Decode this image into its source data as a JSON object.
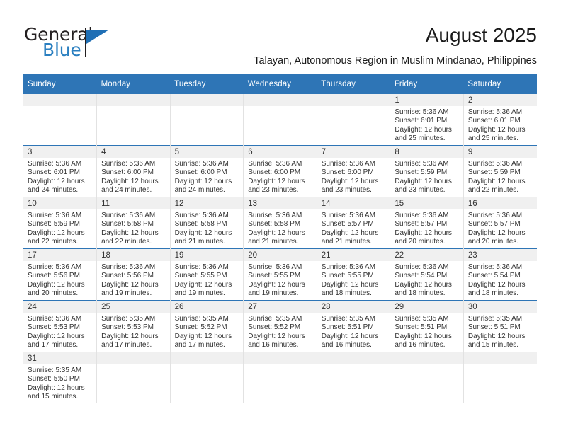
{
  "brand": {
    "name_part1": "General",
    "name_part2": "Blue",
    "accent_color": "#2e75b6",
    "logo_icon": "triangle-flag-icon"
  },
  "header": {
    "title": "August 2025",
    "subtitle": "Talayan, Autonomous Region in Muslim Mindanao, Philippines"
  },
  "calendar": {
    "weekday_headers": [
      "Sunday",
      "Monday",
      "Tuesday",
      "Wednesday",
      "Thursday",
      "Friday",
      "Saturday"
    ],
    "weeks": [
      [
        {
          "day": "",
          "sunrise": "",
          "sunset": "",
          "daylight_line1": "",
          "daylight_line2": ""
        },
        {
          "day": "",
          "sunrise": "",
          "sunset": "",
          "daylight_line1": "",
          "daylight_line2": ""
        },
        {
          "day": "",
          "sunrise": "",
          "sunset": "",
          "daylight_line1": "",
          "daylight_line2": ""
        },
        {
          "day": "",
          "sunrise": "",
          "sunset": "",
          "daylight_line1": "",
          "daylight_line2": ""
        },
        {
          "day": "",
          "sunrise": "",
          "sunset": "",
          "daylight_line1": "",
          "daylight_line2": ""
        },
        {
          "day": "1",
          "sunrise": "Sunrise: 5:36 AM",
          "sunset": "Sunset: 6:01 PM",
          "daylight_line1": "Daylight: 12 hours",
          "daylight_line2": "and 25 minutes."
        },
        {
          "day": "2",
          "sunrise": "Sunrise: 5:36 AM",
          "sunset": "Sunset: 6:01 PM",
          "daylight_line1": "Daylight: 12 hours",
          "daylight_line2": "and 25 minutes."
        }
      ],
      [
        {
          "day": "3",
          "sunrise": "Sunrise: 5:36 AM",
          "sunset": "Sunset: 6:01 PM",
          "daylight_line1": "Daylight: 12 hours",
          "daylight_line2": "and 24 minutes."
        },
        {
          "day": "4",
          "sunrise": "Sunrise: 5:36 AM",
          "sunset": "Sunset: 6:00 PM",
          "daylight_line1": "Daylight: 12 hours",
          "daylight_line2": "and 24 minutes."
        },
        {
          "day": "5",
          "sunrise": "Sunrise: 5:36 AM",
          "sunset": "Sunset: 6:00 PM",
          "daylight_line1": "Daylight: 12 hours",
          "daylight_line2": "and 24 minutes."
        },
        {
          "day": "6",
          "sunrise": "Sunrise: 5:36 AM",
          "sunset": "Sunset: 6:00 PM",
          "daylight_line1": "Daylight: 12 hours",
          "daylight_line2": "and 23 minutes."
        },
        {
          "day": "7",
          "sunrise": "Sunrise: 5:36 AM",
          "sunset": "Sunset: 6:00 PM",
          "daylight_line1": "Daylight: 12 hours",
          "daylight_line2": "and 23 minutes."
        },
        {
          "day": "8",
          "sunrise": "Sunrise: 5:36 AM",
          "sunset": "Sunset: 5:59 PM",
          "daylight_line1": "Daylight: 12 hours",
          "daylight_line2": "and 23 minutes."
        },
        {
          "day": "9",
          "sunrise": "Sunrise: 5:36 AM",
          "sunset": "Sunset: 5:59 PM",
          "daylight_line1": "Daylight: 12 hours",
          "daylight_line2": "and 22 minutes."
        }
      ],
      [
        {
          "day": "10",
          "sunrise": "Sunrise: 5:36 AM",
          "sunset": "Sunset: 5:59 PM",
          "daylight_line1": "Daylight: 12 hours",
          "daylight_line2": "and 22 minutes."
        },
        {
          "day": "11",
          "sunrise": "Sunrise: 5:36 AM",
          "sunset": "Sunset: 5:58 PM",
          "daylight_line1": "Daylight: 12 hours",
          "daylight_line2": "and 22 minutes."
        },
        {
          "day": "12",
          "sunrise": "Sunrise: 5:36 AM",
          "sunset": "Sunset: 5:58 PM",
          "daylight_line1": "Daylight: 12 hours",
          "daylight_line2": "and 21 minutes."
        },
        {
          "day": "13",
          "sunrise": "Sunrise: 5:36 AM",
          "sunset": "Sunset: 5:58 PM",
          "daylight_line1": "Daylight: 12 hours",
          "daylight_line2": "and 21 minutes."
        },
        {
          "day": "14",
          "sunrise": "Sunrise: 5:36 AM",
          "sunset": "Sunset: 5:57 PM",
          "daylight_line1": "Daylight: 12 hours",
          "daylight_line2": "and 21 minutes."
        },
        {
          "day": "15",
          "sunrise": "Sunrise: 5:36 AM",
          "sunset": "Sunset: 5:57 PM",
          "daylight_line1": "Daylight: 12 hours",
          "daylight_line2": "and 20 minutes."
        },
        {
          "day": "16",
          "sunrise": "Sunrise: 5:36 AM",
          "sunset": "Sunset: 5:57 PM",
          "daylight_line1": "Daylight: 12 hours",
          "daylight_line2": "and 20 minutes."
        }
      ],
      [
        {
          "day": "17",
          "sunrise": "Sunrise: 5:36 AM",
          "sunset": "Sunset: 5:56 PM",
          "daylight_line1": "Daylight: 12 hours",
          "daylight_line2": "and 20 minutes."
        },
        {
          "day": "18",
          "sunrise": "Sunrise: 5:36 AM",
          "sunset": "Sunset: 5:56 PM",
          "daylight_line1": "Daylight: 12 hours",
          "daylight_line2": "and 19 minutes."
        },
        {
          "day": "19",
          "sunrise": "Sunrise: 5:36 AM",
          "sunset": "Sunset: 5:55 PM",
          "daylight_line1": "Daylight: 12 hours",
          "daylight_line2": "and 19 minutes."
        },
        {
          "day": "20",
          "sunrise": "Sunrise: 5:36 AM",
          "sunset": "Sunset: 5:55 PM",
          "daylight_line1": "Daylight: 12 hours",
          "daylight_line2": "and 19 minutes."
        },
        {
          "day": "21",
          "sunrise": "Sunrise: 5:36 AM",
          "sunset": "Sunset: 5:55 PM",
          "daylight_line1": "Daylight: 12 hours",
          "daylight_line2": "and 18 minutes."
        },
        {
          "day": "22",
          "sunrise": "Sunrise: 5:36 AM",
          "sunset": "Sunset: 5:54 PM",
          "daylight_line1": "Daylight: 12 hours",
          "daylight_line2": "and 18 minutes."
        },
        {
          "day": "23",
          "sunrise": "Sunrise: 5:36 AM",
          "sunset": "Sunset: 5:54 PM",
          "daylight_line1": "Daylight: 12 hours",
          "daylight_line2": "and 18 minutes."
        }
      ],
      [
        {
          "day": "24",
          "sunrise": "Sunrise: 5:36 AM",
          "sunset": "Sunset: 5:53 PM",
          "daylight_line1": "Daylight: 12 hours",
          "daylight_line2": "and 17 minutes."
        },
        {
          "day": "25",
          "sunrise": "Sunrise: 5:35 AM",
          "sunset": "Sunset: 5:53 PM",
          "daylight_line1": "Daylight: 12 hours",
          "daylight_line2": "and 17 minutes."
        },
        {
          "day": "26",
          "sunrise": "Sunrise: 5:35 AM",
          "sunset": "Sunset: 5:52 PM",
          "daylight_line1": "Daylight: 12 hours",
          "daylight_line2": "and 17 minutes."
        },
        {
          "day": "27",
          "sunrise": "Sunrise: 5:35 AM",
          "sunset": "Sunset: 5:52 PM",
          "daylight_line1": "Daylight: 12 hours",
          "daylight_line2": "and 16 minutes."
        },
        {
          "day": "28",
          "sunrise": "Sunrise: 5:35 AM",
          "sunset": "Sunset: 5:51 PM",
          "daylight_line1": "Daylight: 12 hours",
          "daylight_line2": "and 16 minutes."
        },
        {
          "day": "29",
          "sunrise": "Sunrise: 5:35 AM",
          "sunset": "Sunset: 5:51 PM",
          "daylight_line1": "Daylight: 12 hours",
          "daylight_line2": "and 16 minutes."
        },
        {
          "day": "30",
          "sunrise": "Sunrise: 5:35 AM",
          "sunset": "Sunset: 5:51 PM",
          "daylight_line1": "Daylight: 12 hours",
          "daylight_line2": "and 15 minutes."
        }
      ],
      [
        {
          "day": "31",
          "sunrise": "Sunrise: 5:35 AM",
          "sunset": "Sunset: 5:50 PM",
          "daylight_line1": "Daylight: 12 hours",
          "daylight_line2": "and 15 minutes."
        },
        {
          "day": "",
          "sunrise": "",
          "sunset": "",
          "daylight_line1": "",
          "daylight_line2": ""
        },
        {
          "day": "",
          "sunrise": "",
          "sunset": "",
          "daylight_line1": "",
          "daylight_line2": ""
        },
        {
          "day": "",
          "sunrise": "",
          "sunset": "",
          "daylight_line1": "",
          "daylight_line2": ""
        },
        {
          "day": "",
          "sunrise": "",
          "sunset": "",
          "daylight_line1": "",
          "daylight_line2": ""
        },
        {
          "day": "",
          "sunrise": "",
          "sunset": "",
          "daylight_line1": "",
          "daylight_line2": ""
        },
        {
          "day": "",
          "sunrise": "",
          "sunset": "",
          "daylight_line1": "",
          "daylight_line2": ""
        }
      ]
    ]
  }
}
